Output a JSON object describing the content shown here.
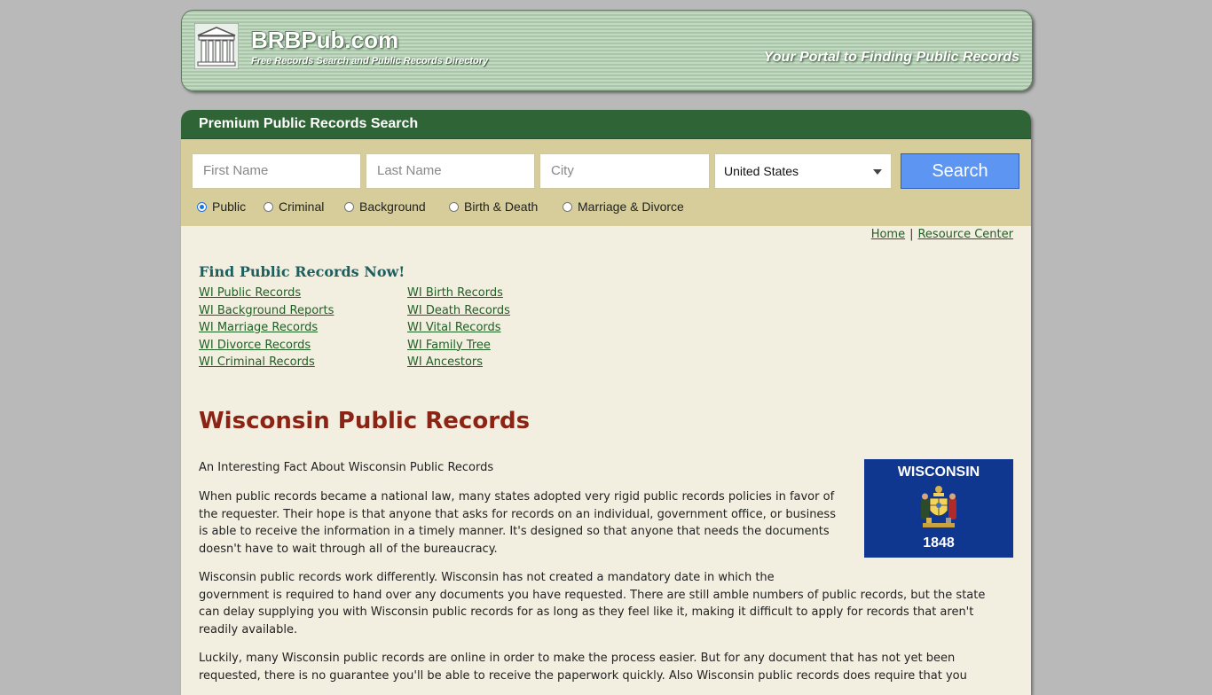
{
  "header": {
    "site_name": "BRBPub.com",
    "tagline": "Free Records Search and Public Records Directory",
    "portal_text": "Your Portal to Finding Public Records"
  },
  "search": {
    "heading": "Premium Public Records Search",
    "first_name_placeholder": "First Name",
    "last_name_placeholder": "Last Name",
    "city_placeholder": "City",
    "country_selected": "United States",
    "button_label": "Search",
    "radio_options": [
      {
        "label": "Public",
        "selected": true
      },
      {
        "label": "Criminal",
        "selected": false
      },
      {
        "label": "Background",
        "selected": false
      },
      {
        "label": "Birth & Death",
        "selected": false
      },
      {
        "label": "Marriage & Divorce",
        "selected": false
      }
    ]
  },
  "nav": {
    "home": "Home",
    "separator": "|",
    "resource_center": "Resource Center"
  },
  "find": {
    "title": "Find Public Records Now!",
    "col1": [
      "WI Public Records",
      "WI Background Reports",
      "WI Marriage Records",
      "WI Divorce Records",
      "WI Criminal Records"
    ],
    "col2": [
      "WI Birth Records",
      "WI Death Records",
      "WI Vital Records",
      "WI Family Tree",
      "WI Ancestors"
    ]
  },
  "content": {
    "title": "Wisconsin Public Records",
    "fact_heading": "An Interesting Fact About Wisconsin Public Records",
    "p1": "When public records became a national law, many states adopted very rigid public records policies in favor of the requester. Their hope is that anyone that asks for records on an individual, government office, or business is able to receive the information in a timely manner. It's designed so that anyone that needs the documents doesn't have to wait through all of the bureaucracy.",
    "p2a": "Wisconsin public records work differently. Wisconsin has not created a mandatory date in which the",
    "p2b": "government is required to hand over any documents you have requested. There are still amble numbers of public records, but the state can delay supplying you with Wisconsin public records for as long as they feel like it, making it difficult to apply for records that aren't readily available.",
    "p3": "Luckily, many Wisconsin public records are online in order to make the process easier. But for any document that has not yet been requested, there is no guarantee you'll be able to receive the paperwork quickly. Also Wisconsin public records does require that you"
  },
  "flag": {
    "name": "WISCONSIN",
    "year": "1848",
    "color": "#0f3790"
  },
  "colors": {
    "header_green": "#2f6436",
    "search_bg": "#d6cd9b",
    "content_bg": "#f2eee0",
    "title_red": "#8b2414",
    "link_green": "#1f5f24",
    "button_blue": "#5c96f2"
  }
}
